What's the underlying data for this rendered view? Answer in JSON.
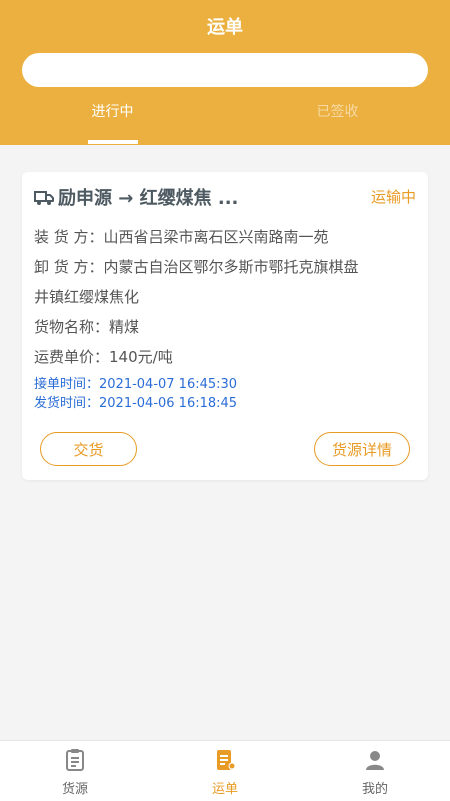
{
  "header": {
    "title": "运单",
    "search": {
      "value": "",
      "placeholder": ""
    }
  },
  "tabs": [
    {
      "label": "进行中",
      "active": true
    },
    {
      "label": "已签收",
      "active": false
    }
  ],
  "card": {
    "route": "励申源 → 红缨煤焦 ...",
    "status": "运输中",
    "loading_label": "装 货 方：",
    "loading_value": "山西省吕梁市离石区兴南路南一苑",
    "unloading_label": "卸 货 方：",
    "unloading_value_line1": "内蒙古自治区鄂尔多斯市鄂托克旗棋盘",
    "unloading_value_line2": "井镇红缨煤焦化",
    "goods_label": "货物名称：",
    "goods_value": "精煤",
    "price_label": "运费单价：",
    "price_value": "140元/吨",
    "accept_time": "接单时间：2021-04-07 16:45:30",
    "ship_time": "发货时间：2021-04-06 16:18:45",
    "deliver_button": "交货",
    "detail_button": "货源详情"
  },
  "bottom_nav": [
    {
      "label": "货源",
      "icon": "clipboard-icon",
      "active": false
    },
    {
      "label": "运单",
      "icon": "waybill-icon",
      "active": true
    },
    {
      "label": "我的",
      "icon": "user-icon",
      "active": false
    }
  ],
  "colors": {
    "brand": "#ebb03f",
    "accent": "#e89b25",
    "time_blue": "#2b6dd6"
  }
}
